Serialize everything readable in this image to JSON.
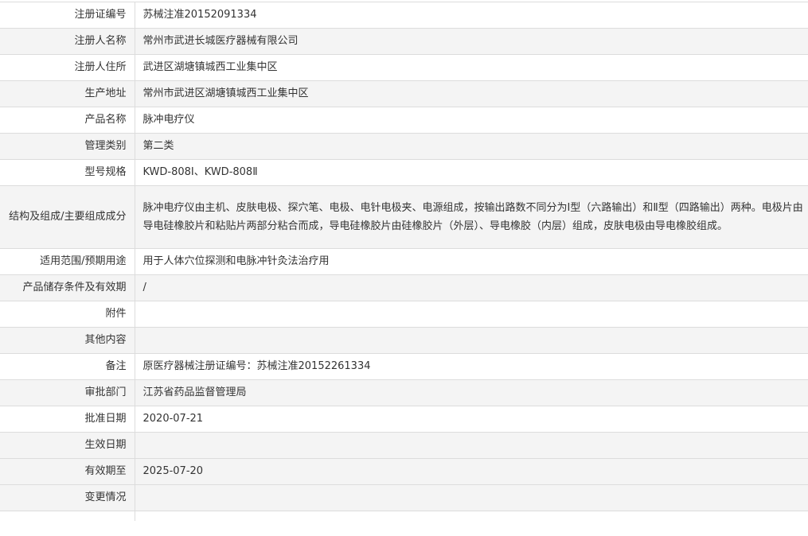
{
  "rows": [
    {
      "label": "注册证编号",
      "value": "苏械注准20152091334"
    },
    {
      "label": "注册人名称",
      "value": "常州市武进长城医疗器械有限公司"
    },
    {
      "label": "注册人住所",
      "value": "武进区湖塘镇城西工业集中区"
    },
    {
      "label": "生产地址",
      "value": "常州市武进区湖塘镇城西工业集中区"
    },
    {
      "label": "产品名称",
      "value": "脉冲电疗仪"
    },
    {
      "label": "管理类别",
      "value": "第二类"
    },
    {
      "label": "型号规格",
      "value": "KWD-808Ⅰ、KWD-808Ⅱ"
    },
    {
      "label": "结构及组成/主要组成成分",
      "value": "脉冲电疗仪由主机、皮肤电极、探穴笔、电极、电针电极夹、电源组成，按输出路数不同分为Ⅰ型（六路输出）和Ⅱ型（四路输出）两种。电极片由导电硅橡胶片和粘贴片两部分粘合而成，导电硅橡胶片由硅橡胶片（外层）、导电橡胶（内层）组成，皮肤电极由导电橡胶组成。"
    },
    {
      "label": "适用范围/预期用途",
      "value": "用于人体穴位探测和电脉冲针灸法治疗用"
    },
    {
      "label": "产品储存条件及有效期",
      "value": "/"
    },
    {
      "label": "附件",
      "value": ""
    },
    {
      "label": "其他内容",
      "value": ""
    },
    {
      "label": "备注",
      "value": "原医疗器械注册证编号：苏械注准20152261334"
    },
    {
      "label": "审批部门",
      "value": "江苏省药品监督管理局"
    },
    {
      "label": "批准日期",
      "value": "2020-07-21"
    },
    {
      "label": "生效日期",
      "value": ""
    },
    {
      "label": "有效期至",
      "value": "2025-07-20"
    },
    {
      "label": "变更情况",
      "value": ""
    }
  ]
}
